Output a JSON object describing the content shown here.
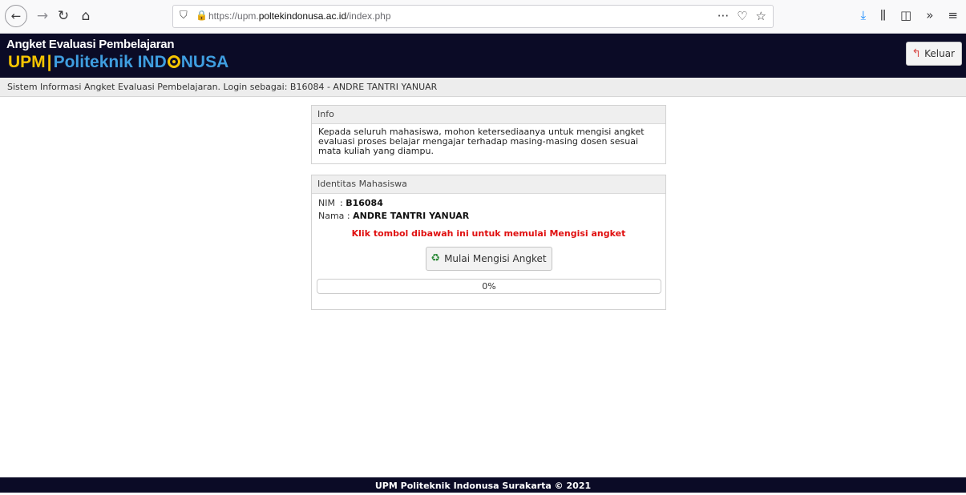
{
  "browser": {
    "url_prefix": "https://upm.",
    "url_domain": "poltekindonusa.ac.id",
    "url_path": "/index.php",
    "icons": {
      "back": "←",
      "forward": "→",
      "reload": "↻",
      "home": "⌂",
      "shield": "⛉",
      "lock": "🔒",
      "more": "···",
      "pocket": "♡",
      "bookmark": "☆",
      "download": "⤓",
      "library": "⫼",
      "sidebar": "◫",
      "overflow": "»",
      "menu": "≡"
    }
  },
  "header": {
    "title_small": "Angket Evaluasi Pembelajaran",
    "brand_upm": "UPM",
    "brand_sep": "|",
    "brand_poli": "Politeknik IND",
    "brand_tail": "NUSA",
    "logout_label": "Keluar",
    "logout_icon": "↰"
  },
  "subheader": {
    "text": "Sistem Informasi Angket Evaluasi Pembelajaran. Login sebagai: B16084 - ANDRE TANTRI YANUAR"
  },
  "info_panel": {
    "title": "Info",
    "body": "Kepada seluruh mahasiswa, mohon ketersediaanya untuk mengisi angket evaluasi proses belajar mengajar terhadap masing-masing dosen sesuai mata kuliah yang diampu."
  },
  "identity_panel": {
    "title": "Identitas Mahasiswa",
    "nim_label": "NIM",
    "nim_sep": ": ",
    "nim_value": "B16084",
    "name_label": "Nama",
    "name_sep": " : ",
    "name_value": "ANDRE TANTRI YANUAR",
    "instruction": "Klik tombol dibawah ini untuk memulai Mengisi angket",
    "start_label": "Mulai Mengisi Angket",
    "start_icon": "♻",
    "progress_text": "0%",
    "progress_value": 0
  },
  "footer": {
    "text": "UPM Politeknik Indonusa Surakarta © 2021"
  }
}
